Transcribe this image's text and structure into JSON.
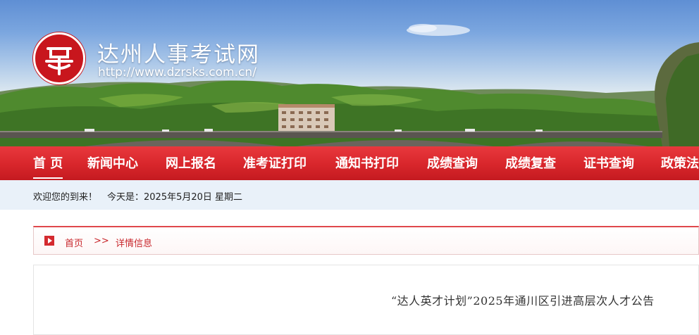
{
  "header": {
    "site_name": "达州人事考试网",
    "site_url": "http://www.dzrsks.com.cn/",
    "logo_icon": "seal-logo-icon"
  },
  "nav": {
    "items": [
      {
        "label": "首 页",
        "active": true
      },
      {
        "label": "新闻中心"
      },
      {
        "label": "网上报名"
      },
      {
        "label": "准考证打印"
      },
      {
        "label": "通知书打印"
      },
      {
        "label": "成绩查询"
      },
      {
        "label": "成绩复查"
      },
      {
        "label": "证书查询"
      },
      {
        "label": "政策法"
      }
    ]
  },
  "welcome": {
    "greeting": "欢迎您的到来！",
    "today": "今天是：2025年5月20日 星期二"
  },
  "breadcrumb": {
    "home": "首页",
    "separator": ">>",
    "current": "详情信息"
  },
  "article": {
    "title": "“达人英才计划”2025年通川区引进高层次人才公告"
  },
  "colors": {
    "nav_red": "#d8262b",
    "welcome_bg": "#e9f1f9",
    "crumb_text": "#c8262b"
  }
}
